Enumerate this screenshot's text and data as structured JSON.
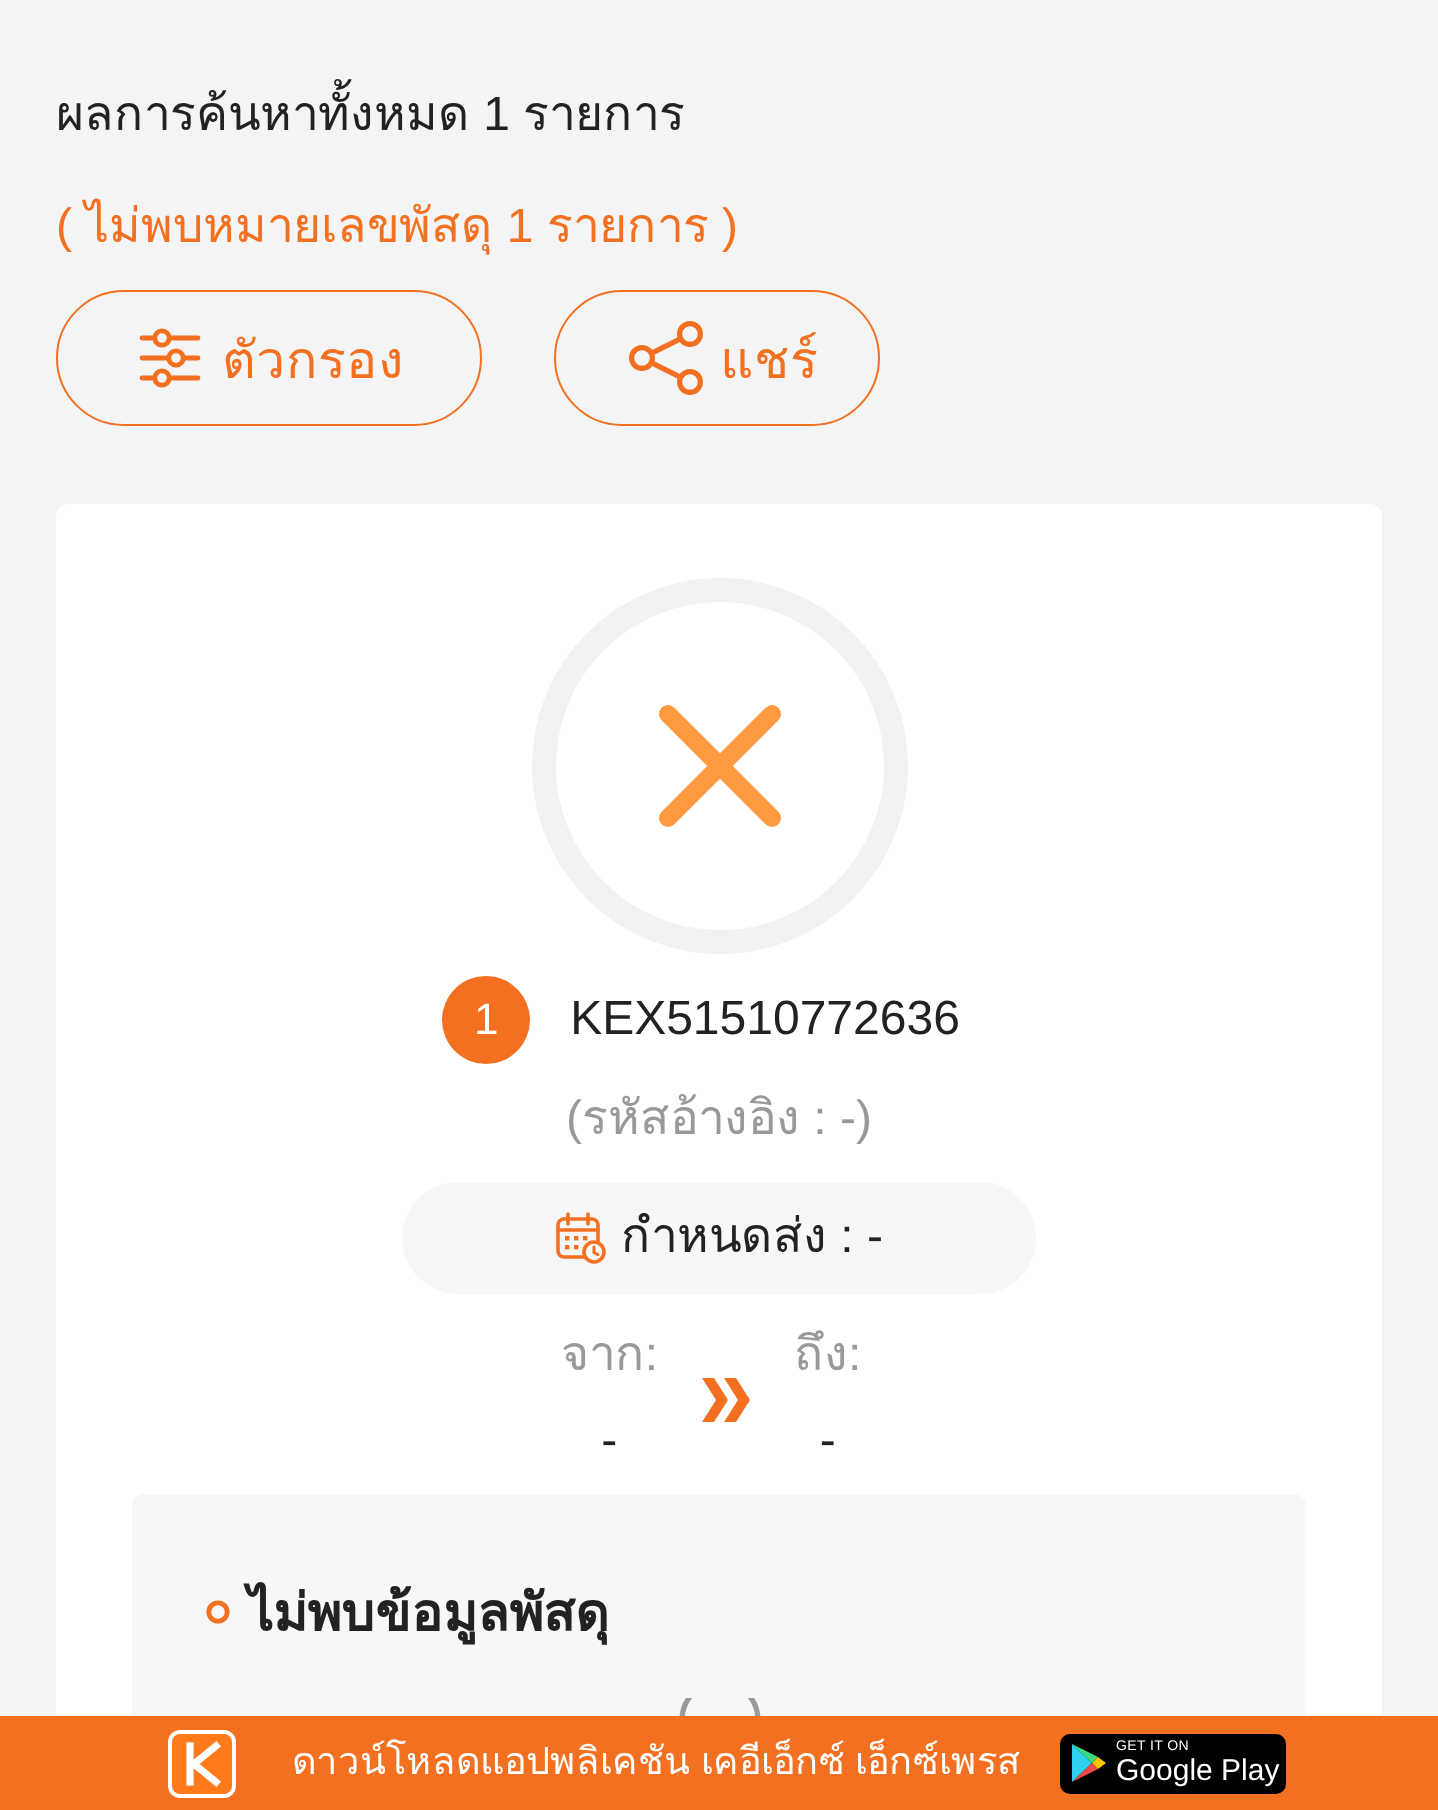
{
  "summary": {
    "title": "ผลการค้นหาทั้งหมด 1 รายการ",
    "not_found_note": "( ไม่พบหมายเลขพัสดุ 1 รายการ )"
  },
  "actions": [
    {
      "kind": "filter",
      "label": "ตัวกรอง"
    },
    {
      "kind": "share",
      "label": "แชร์"
    }
  ],
  "result": {
    "found": false,
    "index": "1",
    "tracking_number": "KEX51510772636",
    "reference": "(รหัสอ้างอิง : -)",
    "due_date": "กำหนดส่ง : -",
    "from": {
      "label": "จาก:",
      "value": "-"
    },
    "to": {
      "label": "ถึง:",
      "value": "-"
    },
    "details": {
      "heading": "ไม่พบข้อมูลพัสดุ"
    }
  },
  "app_banner": {
    "text": "ดาวน์โหลดแอปพลิเคชัน เคอีเอ็กซ์ เอ็กซ์เพรส",
    "store_badge": {
      "caption": "GET IT ON",
      "store": "Google Play"
    }
  }
}
